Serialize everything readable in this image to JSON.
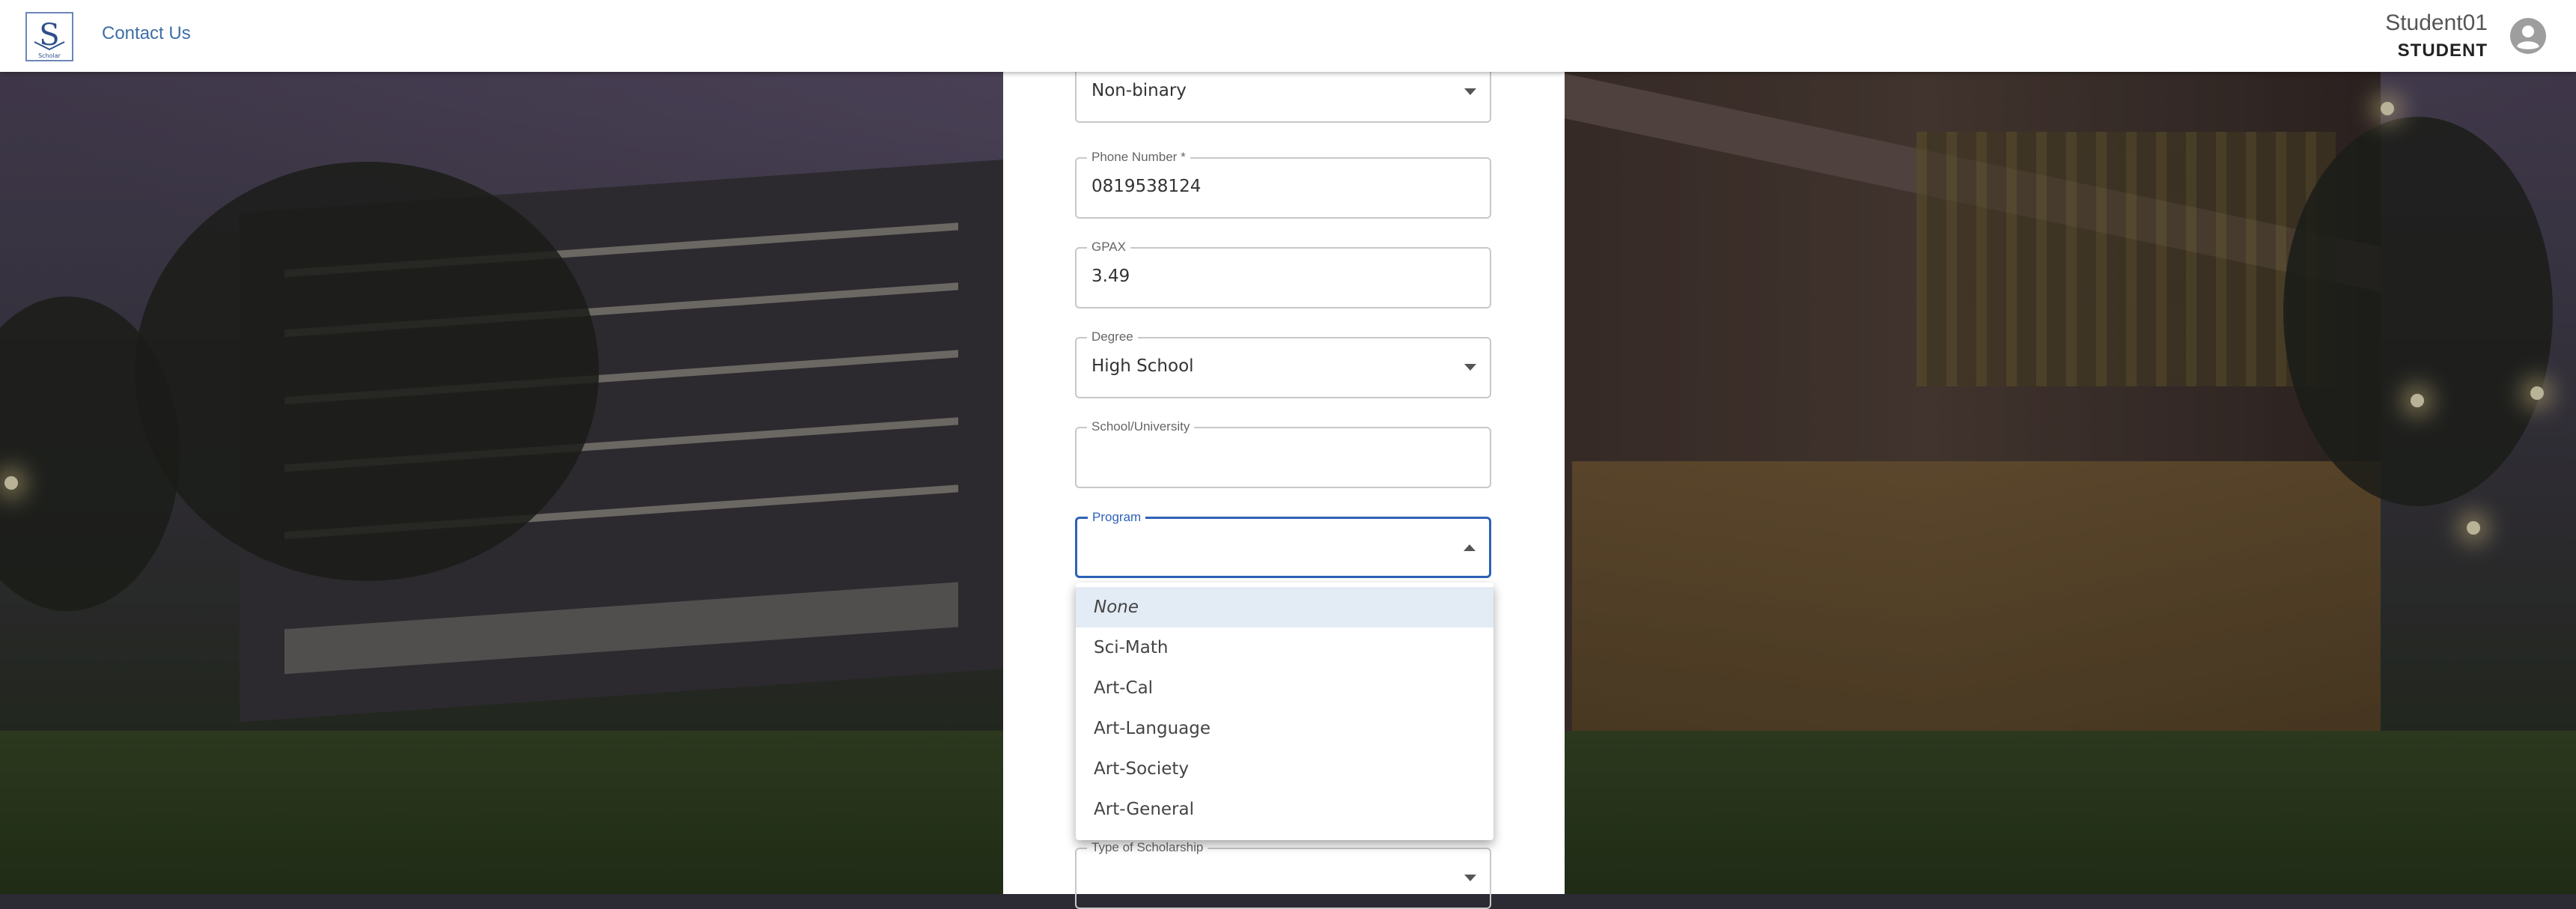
{
  "header": {
    "logo_text": "Scholar",
    "contact_label": "Contact Us",
    "user_name": "Student01",
    "user_role": "STUDENT"
  },
  "form": {
    "gender": {
      "value": "Non-binary"
    },
    "phone": {
      "label": "Phone Number *",
      "value": "0819538124"
    },
    "gpax": {
      "label": "GPAX",
      "value": "3.49"
    },
    "degree": {
      "label": "Degree",
      "value": "High School"
    },
    "school": {
      "label": "School/University",
      "value": ""
    },
    "program": {
      "label": "Program",
      "value": ""
    },
    "scholarship_type": {
      "label": "Type of Scholarship",
      "value": ""
    }
  },
  "program_menu": {
    "options": [
      "None",
      "Sci-Math",
      "Art-Cal",
      "Art-Language",
      "Art-Society",
      "Art-General"
    ],
    "highlighted": "None"
  },
  "colors": {
    "accent": "#2e62b7",
    "link": "#3f6ea8",
    "highlight": "#e3ebf5"
  }
}
